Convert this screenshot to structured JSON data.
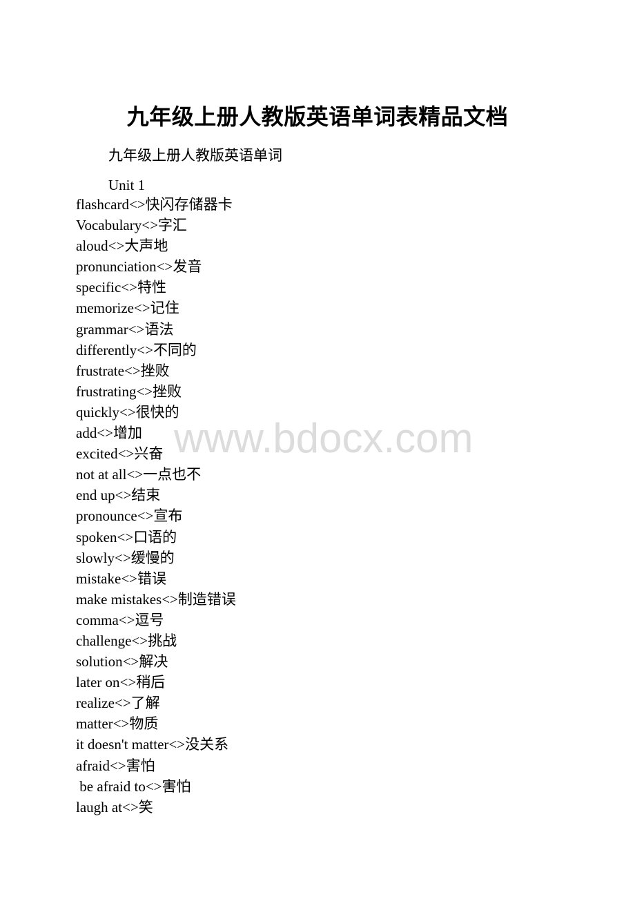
{
  "document": {
    "title": "九年级上册人教版英语单词表精品文档",
    "subtitle": "九年级上册人教版英语单词",
    "unit_heading": "Unit 1",
    "separator": "<>",
    "watermark": "www.bdocx.com",
    "words": [
      {
        "en": "flashcard",
        "zh": "快闪存储器卡"
      },
      {
        "en": "Vocabulary",
        "zh": "字汇"
      },
      {
        "en": "aloud",
        "zh": "大声地"
      },
      {
        "en": "pronunciation",
        "zh": "发音"
      },
      {
        "en": "specific",
        "zh": "特性"
      },
      {
        "en": "memorize",
        "zh": "记住"
      },
      {
        "en": "grammar",
        "zh": "语法"
      },
      {
        "en": "differently",
        "zh": "不同的"
      },
      {
        "en": "frustrate",
        "zh": "挫败"
      },
      {
        "en": "frustrating",
        "zh": "挫败"
      },
      {
        "en": "quickly",
        "zh": "很快的"
      },
      {
        "en": "add",
        "zh": "增加"
      },
      {
        "en": "excited",
        "zh": "兴奋"
      },
      {
        "en": "not at all",
        "zh": "一点也不"
      },
      {
        "en": "end up",
        "zh": "结束"
      },
      {
        "en": "pronounce",
        "zh": "宣布"
      },
      {
        "en": "spoken",
        "zh": "口语的"
      },
      {
        "en": "slowly",
        "zh": "缓慢的"
      },
      {
        "en": "mistake",
        "zh": "错误"
      },
      {
        "en": "make mistakes",
        "zh": "制造错误"
      },
      {
        "en": "comma",
        "zh": "逗号"
      },
      {
        "en": "challenge",
        "zh": "挑战"
      },
      {
        "en": "solution",
        "zh": "解决"
      },
      {
        "en": "later on",
        "zh": "稍后"
      },
      {
        "en": "realize",
        "zh": "了解"
      },
      {
        "en": "matter",
        "zh": "物质"
      },
      {
        "en": "it doesn't matter",
        "zh": "没关系"
      },
      {
        "en": "afraid",
        "zh": "害怕"
      },
      {
        "en": " be afraid to",
        "zh": "害怕"
      },
      {
        "en": "laugh at",
        "zh": "笑"
      }
    ]
  }
}
